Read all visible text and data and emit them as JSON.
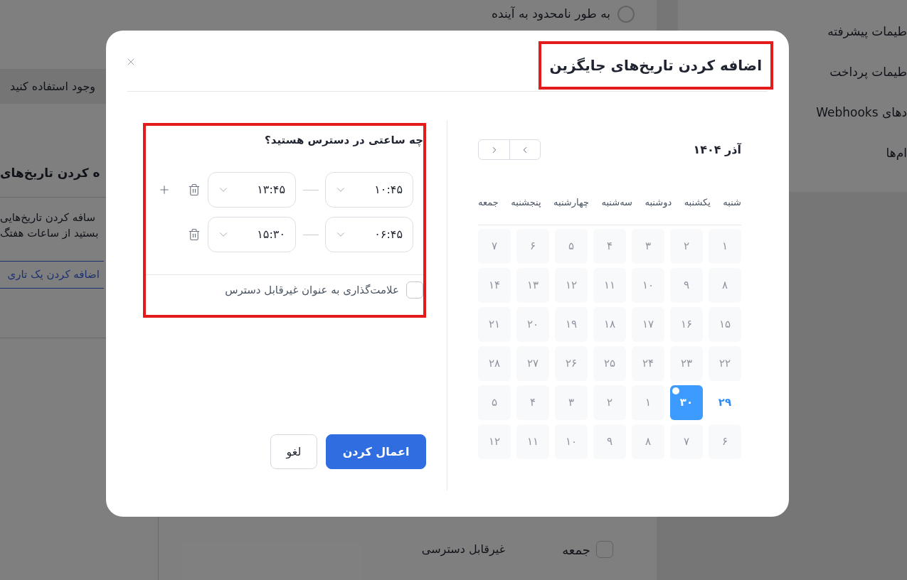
{
  "background": {
    "schedule_limit_option": {
      "label": "به طور نامحدود به آینده",
      "selected": false
    },
    "banner": {
      "text": "وجود استفاده کنید"
    },
    "date_overrides": {
      "title": "ه کردن تاریخ‌های",
      "description_lines": [
        "سافه کردن تاریخ‌هایی",
        "بستید از ساعات هفتگ"
      ],
      "add_button": "اضافه کردن یک تاری"
    },
    "weekly_hours": [
      {
        "day": "جمعه",
        "checked": false,
        "status": "غیرقابل دسترسی"
      }
    ],
    "sidebar": {
      "items": [
        {
          "label": "طیمات پیشرفته",
          "selected": false
        },
        {
          "label": "طیمات پرداخت",
          "selected": false
        },
        {
          "label": "دهای Webhooks",
          "selected": false
        },
        {
          "label": "ام‌ها",
          "selected": false
        }
      ]
    }
  },
  "dialog": {
    "title": "اضافه کردن تاریخ‌های جایگزین",
    "title_highlighted": true,
    "calendar": {
      "month": "آذر ۱۴۰۴",
      "weekdays": [
        "شنبه",
        "یکشنبه",
        "دوشنبه",
        "سه‌شنبه",
        "چهارشنبه",
        "پنجشنبه",
        "جمعه"
      ],
      "days": [
        {
          "label": "۱",
          "disabled": true,
          "selected": false,
          "today": false
        },
        {
          "label": "۲",
          "disabled": true,
          "selected": false,
          "today": false
        },
        {
          "label": "۳",
          "disabled": true,
          "selected": false,
          "today": false
        },
        {
          "label": "۴",
          "disabled": true,
          "selected": false,
          "today": false
        },
        {
          "label": "۵",
          "disabled": true,
          "selected": false,
          "today": false
        },
        {
          "label": "۶",
          "disabled": true,
          "selected": false,
          "today": false
        },
        {
          "label": "۷",
          "disabled": true,
          "selected": false,
          "today": false
        },
        {
          "label": "۸",
          "disabled": true,
          "selected": false,
          "today": false
        },
        {
          "label": "۹",
          "disabled": true,
          "selected": false,
          "today": false
        },
        {
          "label": "۱۰",
          "disabled": true,
          "selected": false,
          "today": false
        },
        {
          "label": "۱۱",
          "disabled": true,
          "selected": false,
          "today": false
        },
        {
          "label": "۱۲",
          "disabled": true,
          "selected": false,
          "today": false
        },
        {
          "label": "۱۳",
          "disabled": true,
          "selected": false,
          "today": false
        },
        {
          "label": "۱۴",
          "disabled": true,
          "selected": false,
          "today": false
        },
        {
          "label": "۱۵",
          "disabled": true,
          "selected": false,
          "today": false
        },
        {
          "label": "۱۶",
          "disabled": true,
          "selected": false,
          "today": false
        },
        {
          "label": "۱۷",
          "disabled": true,
          "selected": false,
          "today": false
        },
        {
          "label": "۱۸",
          "disabled": true,
          "selected": false,
          "today": false
        },
        {
          "label": "۱۹",
          "disabled": true,
          "selected": false,
          "today": false
        },
        {
          "label": "۲۰",
          "disabled": true,
          "selected": false,
          "today": false
        },
        {
          "label": "۲۱",
          "disabled": true,
          "selected": false,
          "today": false
        },
        {
          "label": "۲۲",
          "disabled": true,
          "selected": false,
          "today": false
        },
        {
          "label": "۲۳",
          "disabled": true,
          "selected": false,
          "today": false
        },
        {
          "label": "۲۴",
          "disabled": true,
          "selected": false,
          "today": false
        },
        {
          "label": "۲۵",
          "disabled": true,
          "selected": false,
          "today": false
        },
        {
          "label": "۲۶",
          "disabled": true,
          "selected": false,
          "today": false
        },
        {
          "label": "۲۷",
          "disabled": true,
          "selected": false,
          "today": false
        },
        {
          "label": "۲۸",
          "disabled": true,
          "selected": false,
          "today": false
        },
        {
          "label": "۲۹",
          "disabled": false,
          "selected": false,
          "today": false
        },
        {
          "label": "۳۰",
          "disabled": false,
          "selected": true,
          "today": true
        },
        {
          "label": "۱",
          "disabled": true,
          "selected": false,
          "today": false
        },
        {
          "label": "۲",
          "disabled": true,
          "selected": false,
          "today": false
        },
        {
          "label": "۳",
          "disabled": true,
          "selected": false,
          "today": false
        },
        {
          "label": "۴",
          "disabled": true,
          "selected": false,
          "today": false
        },
        {
          "label": "۵",
          "disabled": true,
          "selected": false,
          "today": false
        },
        {
          "label": "۶",
          "disabled": true,
          "selected": false,
          "today": false
        },
        {
          "label": "۷",
          "disabled": true,
          "selected": false,
          "today": false
        },
        {
          "label": "۸",
          "disabled": true,
          "selected": false,
          "today": false
        },
        {
          "label": "۹",
          "disabled": true,
          "selected": false,
          "today": false
        },
        {
          "label": "۱۰",
          "disabled": true,
          "selected": false,
          "today": false
        },
        {
          "label": "۱۱",
          "disabled": true,
          "selected": false,
          "today": false
        },
        {
          "label": "۱۲",
          "disabled": true,
          "selected": false,
          "today": false
        }
      ]
    },
    "availability": {
      "question": "چه ساعتی در دسترس هستید؟",
      "highlighted": true,
      "ranges": [
        {
          "start": "۱۰:۴۵",
          "end": "۱۳:۴۵",
          "can_add": true
        },
        {
          "start": "۰۶:۴۵",
          "end": "۱۵:۳۰",
          "can_add": false
        }
      ],
      "unavailable_option": {
        "label": "علامت‌گذاری به عنوان غیرقابل دسترس",
        "checked": false
      }
    },
    "buttons": [
      {
        "label": "اعمال کردن",
        "kind": "primary"
      },
      {
        "label": "لغو",
        "kind": "secondary"
      }
    ]
  }
}
